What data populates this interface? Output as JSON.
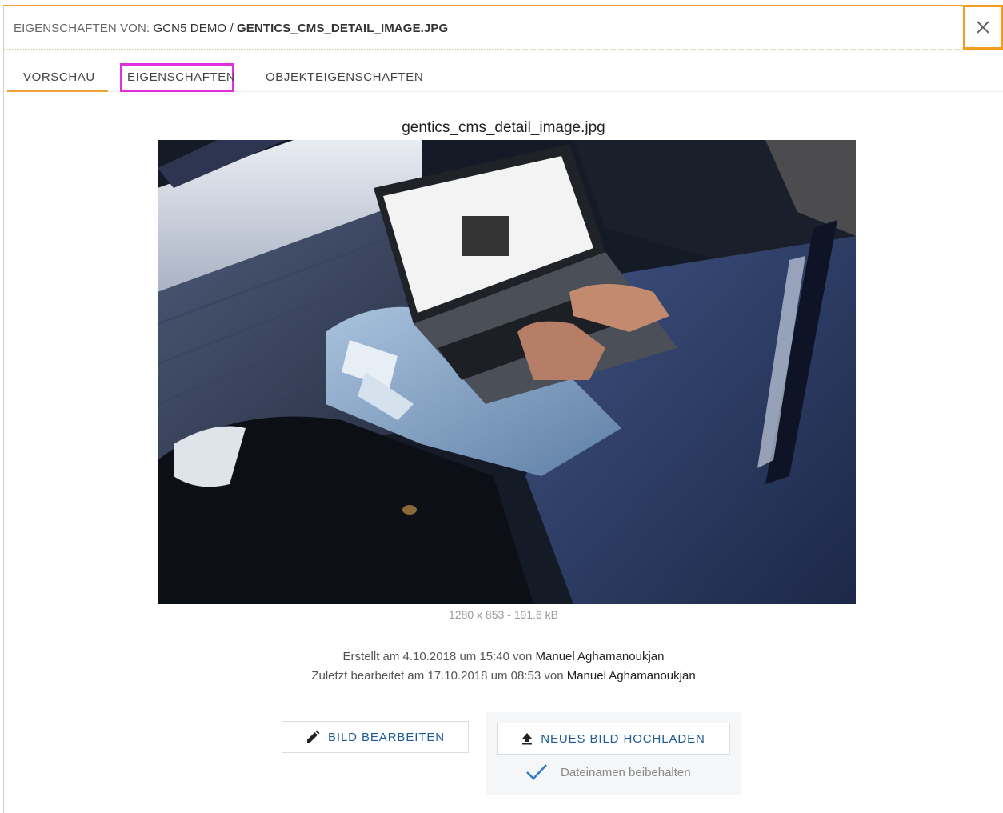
{
  "header": {
    "prefix": "EIGENSCHAFTEN VON:",
    "node": "GCN5 DEMO",
    "separator": "/",
    "file": "GENTICS_CMS_DETAIL_IMAGE.JPG",
    "close_icon": "close-icon"
  },
  "tabs": [
    {
      "label": "VORSCHAU",
      "active": true
    },
    {
      "label": "EIGENSCHAFTEN",
      "active": false,
      "highlighted": true
    },
    {
      "label": "OBJEKTEIGENSCHAFTEN",
      "active": false
    }
  ],
  "preview": {
    "filename": "gentics_cms_detail_image.jpg",
    "dimensions": "1280 x 853 - 191.6 kB",
    "created_prefix": "Erstellt am 4.10.2018 um 15:40 von",
    "created_user": "Manuel Aghamanoukjan",
    "edited_prefix": "Zuletzt bearbeitet am 17.10.2018 um 08:53 von",
    "edited_user": "Manuel Aghamanoukjan"
  },
  "actions": {
    "edit_label": "BILD BEARBEITEN",
    "edit_icon": "pencil-icon",
    "upload_label": "NEUES BILD HOCHLADEN",
    "upload_icon": "upload-icon",
    "keep_filename_label": "Dateinamen beibehalten",
    "keep_filename_checked": true
  },
  "colors": {
    "accent": "#f0a33a",
    "highlight": "#e22ee1",
    "button_text": "#1f5b93"
  }
}
